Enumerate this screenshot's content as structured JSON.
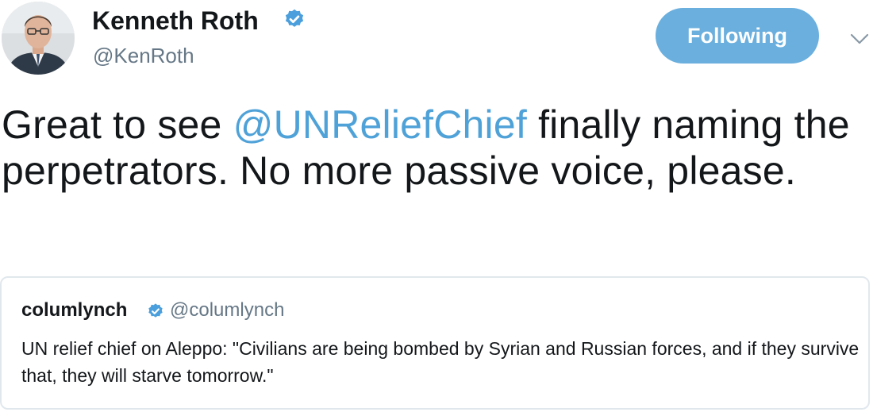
{
  "author": {
    "name": "Kenneth Roth",
    "handle": "@KenRoth",
    "verified": true,
    "avatar_icon": "user-photo-icon"
  },
  "follow_button": {
    "label": "Following",
    "color": "#6aafde"
  },
  "menu": {
    "icon": "chevron-down-icon"
  },
  "tweet": {
    "text_before": "Great to see ",
    "mention": "@UNReliefChief",
    "text_after": " finally naming the perpetrators. No more passive voice, please.",
    "mention_color": "#4fa2d8"
  },
  "quoted_tweet": {
    "name": "columlynch",
    "handle": "@columlynch",
    "verified": true,
    "text": "UN relief chief on Aleppo: \"Civilians are being bombed by Syrian and Russian forces, and if they survive that, they will starve tomorrow.\""
  },
  "colors": {
    "verified_badge": "#4a9fdc",
    "secondary_text": "#657786",
    "card_border": "#e1e8ed"
  }
}
